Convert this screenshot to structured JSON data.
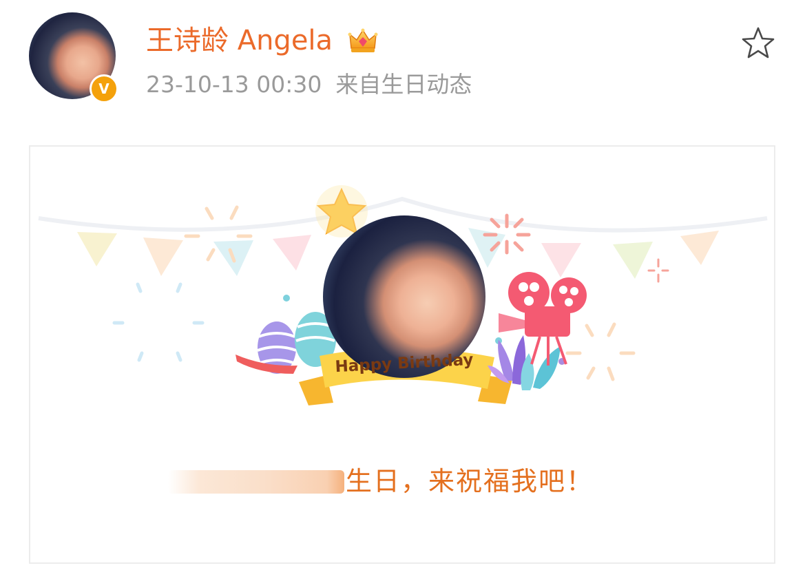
{
  "post": {
    "author": {
      "name": "王诗龄 Angela",
      "verified_badge": "V",
      "crown_icon": "crown-icon"
    },
    "meta": {
      "timestamp": "23-10-13 00:30",
      "source": "来自生日动态"
    },
    "actions": {
      "favorite_icon": "star-outline-icon"
    }
  },
  "card": {
    "ribbon_text": "Happy Birthday",
    "message": "生日，来祝福我吧！"
  },
  "colors": {
    "name": "#eb6a2a",
    "meta": "#9a9a9a",
    "message": "#e4701f",
    "badge": "#f4a10b"
  }
}
